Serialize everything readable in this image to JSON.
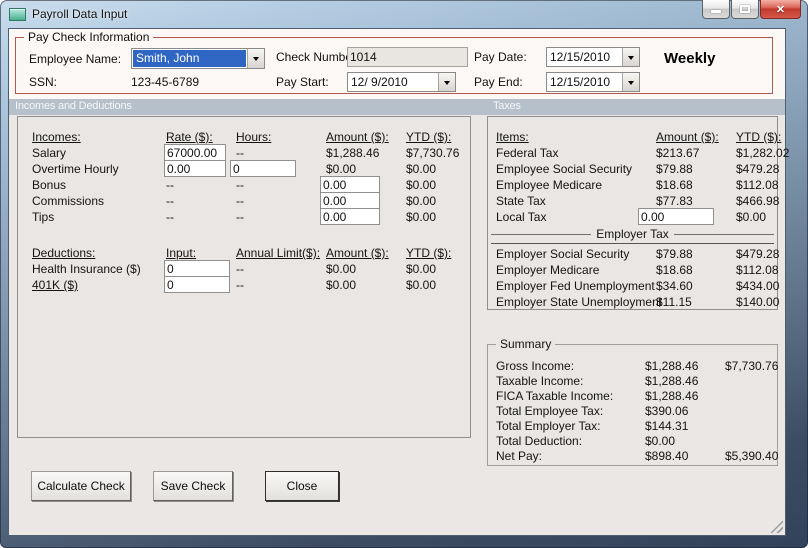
{
  "titlebar": {
    "title": "Payroll Data Input"
  },
  "icons": {
    "close_glyph": "✕"
  },
  "colors": {
    "groupbox_border": "#b4584e",
    "section_band": "#b6c0ca",
    "selection_blue": "#2f66c4",
    "close_button_red": "#c23a2e",
    "titlebar_blue": "#cadded"
  },
  "paycheck": {
    "legend": "Pay Check Information",
    "employee_name_label": "Employee Name:",
    "employee_name_value": "Smith, John",
    "ssn_label": "SSN:",
    "ssn_value": "123-45-6789",
    "check_number_label": "Check Number:",
    "check_number_value": "1014",
    "pay_start_label": "Pay Start:",
    "pay_start_value": "12/ 9/2010",
    "pay_date_label": "Pay Date:",
    "pay_date_value": "12/15/2010",
    "pay_end_label": "Pay End:",
    "pay_end_value": "12/15/2010",
    "frequency": "Weekly"
  },
  "sections": {
    "incomes_deductions": "Incomes and Deductions",
    "taxes": "Taxes"
  },
  "incomes": {
    "headers": {
      "item": "Incomes:",
      "rate": "Rate ($):",
      "hours": "Hours:",
      "amount": "Amount ($):",
      "ytd": "YTD ($):"
    },
    "rows": [
      {
        "label": "Salary",
        "rate": "67000.00",
        "hours": "--",
        "amount": "$1,288.46",
        "ytd": "$7,730.76"
      },
      {
        "label": "Overtime Hourly",
        "rate": "0.00",
        "hours": "0",
        "amount": "$0.00",
        "ytd": "$0.00"
      },
      {
        "label": "Bonus",
        "rate": "--",
        "hours": "--",
        "amount": "0.00",
        "ytd": "$0.00"
      },
      {
        "label": "Commissions",
        "rate": "--",
        "hours": "--",
        "amount": "0.00",
        "ytd": "$0.00"
      },
      {
        "label": "Tips",
        "rate": "--",
        "hours": "--",
        "amount": "0.00",
        "ytd": "$0.00"
      }
    ]
  },
  "deductions": {
    "headers": {
      "item": "Deductions:",
      "input": "Input:",
      "limit": "Annual Limit($):",
      "amount": "Amount ($):",
      "ytd": "YTD ($):"
    },
    "rows": [
      {
        "label": "Health Insurance  ($)",
        "input": "0",
        "limit": "--",
        "amount": "$0.00",
        "ytd": "$0.00"
      },
      {
        "label": "401K  ($)",
        "input": "0",
        "limit": "--",
        "amount": "$0.00",
        "ytd": "$0.00"
      }
    ]
  },
  "taxes": {
    "headers": {
      "item": "Items:",
      "amount": "Amount ($):",
      "ytd": "YTD ($):"
    },
    "employee_rows": [
      {
        "label": "Federal Tax",
        "amount": "$213.67",
        "ytd": "$1,282.02"
      },
      {
        "label": "Employee Social Security",
        "amount": "$79.88",
        "ytd": "$479.28"
      },
      {
        "label": "Employee Medicare",
        "amount": "$18.68",
        "ytd": "$112.08"
      },
      {
        "label": "State Tax",
        "amount": "$77.83",
        "ytd": "$466.98"
      },
      {
        "label": "Local Tax",
        "amount": "0.00",
        "ytd": "$0.00"
      }
    ],
    "employer_caption": "Employer Tax",
    "employer_rows": [
      {
        "label": "Employer Social Security",
        "amount": "$79.88",
        "ytd": "$479.28"
      },
      {
        "label": "Employer Medicare",
        "amount": "$18.68",
        "ytd": "$112.08"
      },
      {
        "label": "Employer Fed Unemployment",
        "amount": "$34.60",
        "ytd": "$434.00"
      },
      {
        "label": "Employer State Unemployment",
        "amount": "$11.15",
        "ytd": "$140.00"
      }
    ]
  },
  "summary": {
    "legend": "Summary",
    "rows": [
      {
        "label": "Gross Income:",
        "amount": "$1,288.46",
        "ytd": "$7,730.76"
      },
      {
        "label": "Taxable Income:",
        "amount": "$1,288.46",
        "ytd": ""
      },
      {
        "label": "FICA Taxable Income:",
        "amount": "$1,288.46",
        "ytd": ""
      },
      {
        "label": "Total Employee Tax:",
        "amount": "$390.06",
        "ytd": ""
      },
      {
        "label": "Total Employer Tax:",
        "amount": "$144.31",
        "ytd": ""
      },
      {
        "label": "Total Deduction:",
        "amount": "$0.00",
        "ytd": ""
      },
      {
        "label": "Net Pay:",
        "amount": "$898.40",
        "ytd": "$5,390.40"
      }
    ]
  },
  "buttons": {
    "calculate": "Calculate Check",
    "save": "Save Check",
    "close": "Close"
  }
}
